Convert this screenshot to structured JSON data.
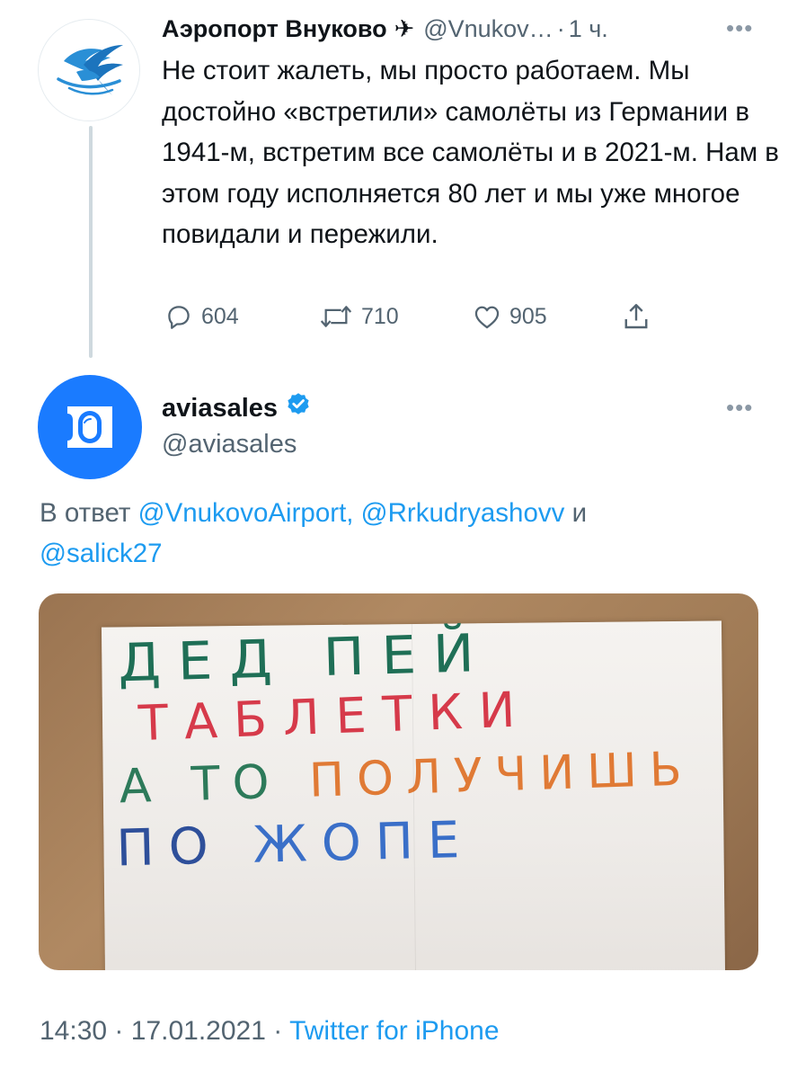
{
  "tweet1": {
    "author_name": "Аэропорт Внуково",
    "name_emoji": "✈",
    "handle": "@Vnukov…",
    "separator": "·",
    "time": "1 ч.",
    "more": "•••",
    "text": "Не стоит жалеть, мы просто работаем. Мы достойно «встретили» самолёты из Германии в 1941-м, встретим все самолёты и в 2021-м. Нам в этом году исполняется 80 лет и мы уже многое повидали и пережили.",
    "replies": "604",
    "retweets": "710",
    "likes": "905"
  },
  "tweet2": {
    "author_name": "aviasales",
    "handle": "@aviasales",
    "more": "•••",
    "reply_prefix": "В ответ",
    "mention_1": "@VnukovoAirport,",
    "mention_2": "@Rrkudryashovv",
    "reply_and": "и",
    "mention_3": "@salick27",
    "photo": {
      "line1": "ДЕД ПЕЙ",
      "line2": "ТАБЛЕТКИ",
      "line3_part1": "А ТО ",
      "line3_part2": "ПОЛУЧИШЬ",
      "line4_part1": "ПО ",
      "line4_part2": "ЖОПЕ"
    },
    "time": "14:30",
    "date": "17.01.2021",
    "separator": "·",
    "source": "Twitter for iPhone"
  },
  "colors": {
    "text": "#0f1419",
    "secondary": "#536471",
    "link": "#1d9bf0",
    "aviasales_blue": "#1a7bff",
    "vnukovo_blue": "#2a8fd6"
  },
  "icons": [
    "vnukovo-logo",
    "airplane-emoji",
    "more-icon",
    "reply-icon",
    "retweet-icon",
    "like-icon",
    "share-icon",
    "aviasales-logo",
    "verified-icon"
  ]
}
